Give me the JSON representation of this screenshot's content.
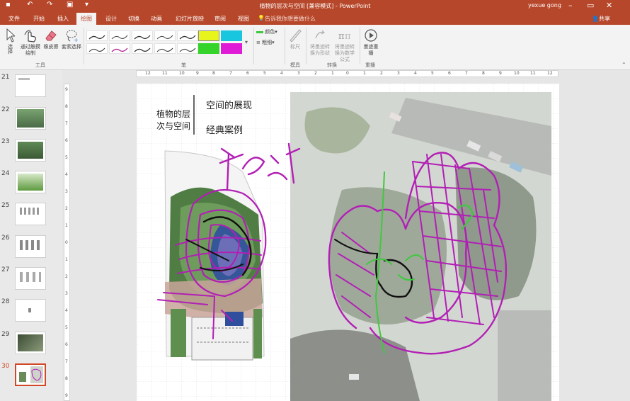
{
  "titlebar": {
    "title": "植物的层次与空间 [兼容模式] - PowerPoint",
    "user": "yexue gong",
    "save_icon": "save-icon",
    "undo_icon": "undo-icon",
    "redo_icon": "redo-icon",
    "start_icon": "start-from-beginning-icon"
  },
  "tabs": [
    "文件",
    "开始",
    "插入",
    "绘图",
    "设计",
    "切换",
    "动画",
    "幻灯片放映",
    "审阅",
    "视图"
  ],
  "active_tab": "绘图",
  "tell_me": "告诉我你想要做什么",
  "share": "共享",
  "ribbon": {
    "tools": {
      "select": "选择",
      "draw_by_touch": "通过触摸绘制",
      "eraser": "橡皮擦",
      "lasso": "套索选择",
      "group_label": "工具"
    },
    "pens_group_label": "笔",
    "color_label": "颜色",
    "thickness_label": "粗细",
    "ruler_label": "标尺",
    "stencils_group_label": "模具",
    "ink_to_shape": "将墨迹转换为形状",
    "ink_to_math": "将墨迹转换为数学公式",
    "convert_group_label": "转换",
    "ink_replay": "墨迹重播",
    "replay_group_label": "重播"
  },
  "ruler_h": [
    "12",
    "11",
    "10",
    "9",
    "8",
    "7",
    "6",
    "5",
    "4",
    "3",
    "2",
    "1",
    "0",
    "1",
    "2",
    "3",
    "4",
    "5",
    "6",
    "7",
    "8",
    "9",
    "10",
    "11",
    "12"
  ],
  "ruler_v": [
    "9",
    "8",
    "7",
    "6",
    "5",
    "4",
    "3",
    "2",
    "1",
    "0",
    "1",
    "2",
    "3",
    "4",
    "5",
    "6",
    "7",
    "8",
    "9"
  ],
  "slides": [
    {
      "num": "21"
    },
    {
      "num": "22"
    },
    {
      "num": "23"
    },
    {
      "num": "24"
    },
    {
      "num": "25"
    },
    {
      "num": "26"
    },
    {
      "num": "27"
    },
    {
      "num": "28"
    },
    {
      "num": "29"
    },
    {
      "num": "30"
    }
  ],
  "active_slide": "30",
  "slide_content": {
    "title": "植物的层次与空间",
    "subtitle_1": "空间的展现",
    "subtitle_2": "经典案例",
    "ink_note": "构成"
  },
  "colors": {
    "accent": "#b7472a",
    "ink_magenta": "#b21fb5",
    "ink_green": "#3fc83f",
    "ink_black": "#111111",
    "highlighter_yellow": "#e8f51d",
    "highlighter_cyan": "#19c6e0"
  }
}
